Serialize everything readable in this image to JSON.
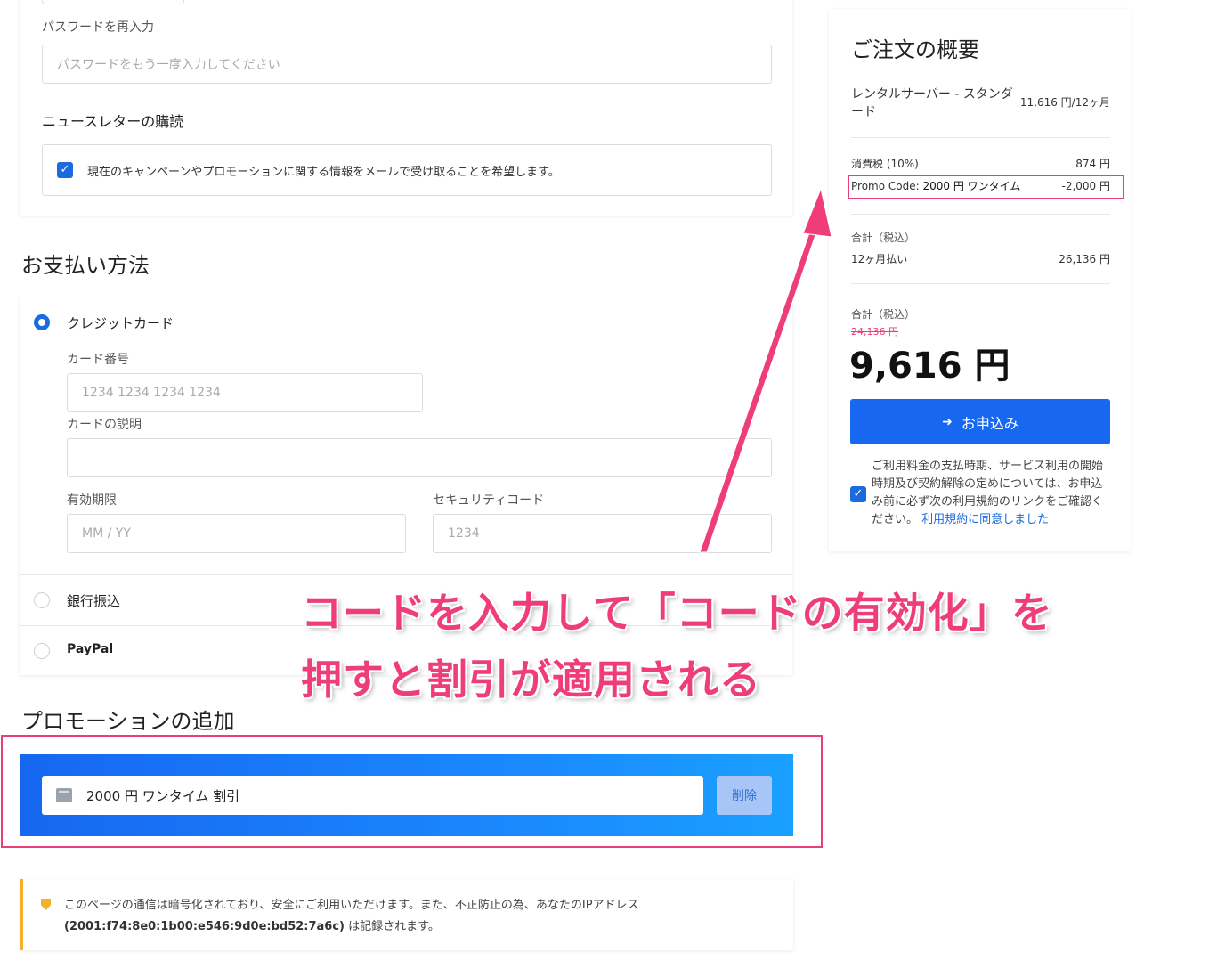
{
  "account": {
    "password_confirm_label": "パスワードを再入力",
    "password_confirm_placeholder": "パスワードをもう一度入力してください",
    "newsletter_title": "ニュースレターの購読",
    "newsletter_text": "現在のキャンペーンやプロモーションに関する情報をメールで受け取ることを希望します。",
    "newsletter_checked": true
  },
  "payment": {
    "title": "お支払い方法",
    "options": [
      {
        "label": "クレジットカード",
        "selected": true
      },
      {
        "label": "銀行振込",
        "selected": false
      },
      {
        "label": "PayPal",
        "selected": false
      }
    ],
    "card_number_label": "カード番号",
    "card_number_placeholder": "1234 1234 1234 1234",
    "card_desc_label": "カードの説明",
    "expiry_label": "有効期限",
    "expiry_placeholder": "MM / YY",
    "cvc_label": "セキュリティコード",
    "cvc_placeholder": "1234"
  },
  "promo": {
    "title": "プロモーションの追加",
    "applied_code": "2000 円 ワンタイム 割引",
    "delete_label": "削除"
  },
  "notice": {
    "text_before": "このページの通信は暗号化されており、安全にご利用いただけます。また、不正防止の為、あなたのIPアドレス",
    "ip": "(2001:f74:8e0:1b00:e546:9d0e:bd52:7a6c)",
    "text_after": " は記録されます。"
  },
  "summary": {
    "title": "ご注文の概要",
    "product_name_line1": "レンタルサーバー - スタンダ",
    "product_name_line2": "ード",
    "product_price": "11,616 円/12ヶ月",
    "tax_label": "消費税 (10%)",
    "tax_value": "874 円",
    "promo_label": "Promo Code: ",
    "promo_name": "2000 円 ワンタイム",
    "promo_value": "-2,000 円",
    "recurring_label": "合計（税込）",
    "recurring_period": "12ヶ月払い",
    "recurring_value": "26,136 円",
    "total_label": "合計（税込）",
    "original_total": "24,136 円",
    "total": "9,616 円",
    "apply_button": "お申込み",
    "terms_text": "ご利用料金の支払時期、サービス利用の開始時期及び契約解除の定めについては、お申込み前に必ず次の利用規約のリンクをご確認ください。",
    "terms_link": "利用規約に同意しました",
    "terms_checked": true
  },
  "annotation": {
    "line1": "コードを入力して「コードの有効化」を",
    "line2": "押すと割引が適用される",
    "color": "#ee3d7a"
  },
  "colors": {
    "accent": "#1767f0",
    "highlight": "#ea3f7c",
    "notice": "#f3b02b"
  }
}
